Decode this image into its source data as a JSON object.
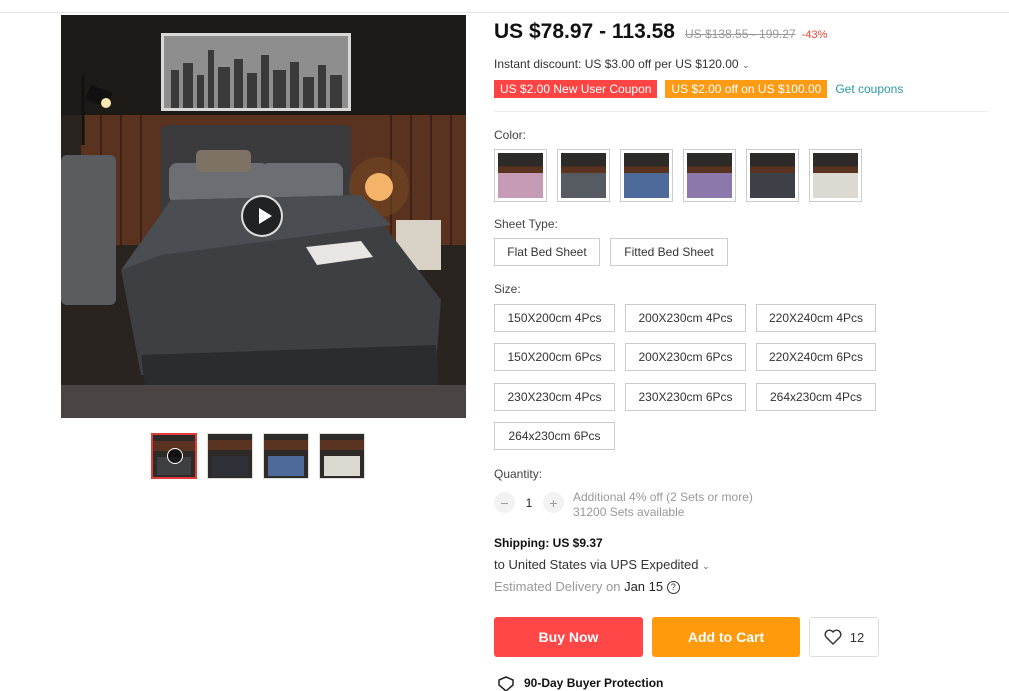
{
  "price": {
    "current": "US $78.97 - 113.58",
    "original": "US $138.55 - 199.27",
    "discount": "-43%"
  },
  "instant_discount": "Instant discount: US $3.00 off per US $120.00",
  "coupons": {
    "new_user": "US $2.00 New User Coupon",
    "spend": "US $2.00 off on US $100.00",
    "get_link": "Get coupons"
  },
  "color": {
    "label": "Color:",
    "swatches": [
      {
        "name": "pink",
        "hex": "#c59bb6"
      },
      {
        "name": "gray",
        "hex": "#565a61"
      },
      {
        "name": "blue",
        "hex": "#4d6a9a"
      },
      {
        "name": "purple",
        "hex": "#8c78ab"
      },
      {
        "name": "dark-gray",
        "hex": "#3e4047"
      },
      {
        "name": "white",
        "hex": "#dcd8d2"
      }
    ]
  },
  "sheet_type": {
    "label": "Sheet Type:",
    "options": [
      "Flat Bed Sheet",
      "Fitted Bed Sheet"
    ]
  },
  "size": {
    "label": "Size:",
    "options": [
      "150X200cm 4Pcs",
      "200X230cm 4Pcs",
      "220X240cm 4Pcs",
      "150X200cm 6Pcs",
      "200X230cm 6Pcs",
      "220X240cm 6Pcs",
      "230X230cm 4Pcs",
      "230X230cm 6Pcs",
      "264x230cm 4Pcs",
      "264x230cm 6Pcs"
    ]
  },
  "quantity": {
    "label": "Quantity:",
    "value": "1",
    "minus": "−",
    "plus": "+",
    "bulk_offer": "Additional 4% off (2 Sets or more)",
    "available": "31200 Sets available"
  },
  "shipping": {
    "cost": "Shipping: US $9.37",
    "route": "to United States via UPS Expedited",
    "estimate_label": "Estimated Delivery on",
    "estimate_date": "Jan 15"
  },
  "actions": {
    "buy_now": "Buy Now",
    "add_to_cart": "Add to Cart",
    "wishlist_count": "12"
  },
  "protection": "90-Day Buyer Protection",
  "colors": {
    "buy_now": "#ff4747",
    "add_to_cart": "#ff9a0d",
    "accent_link": "#2a9aa3"
  },
  "icons": {
    "play": "play-icon",
    "heart": "heart-icon",
    "help": "question-circle-icon",
    "shield": "shield-icon",
    "chevron": "chevron-down-icon"
  }
}
